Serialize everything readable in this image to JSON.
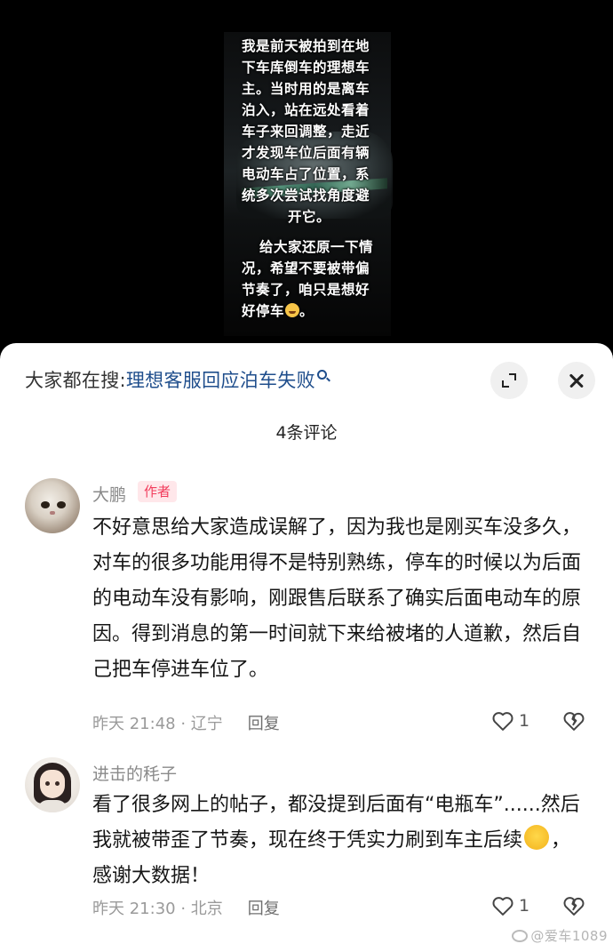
{
  "video": {
    "caption_lines_1": [
      "我是前天被拍到在地",
      "下车库倒车的理想车",
      "主。当时用的是离车",
      "泊入，站在远处看着",
      "车子来回调整，走近",
      "才发现车位后面有辆",
      "电动车占了位置，系",
      "统多次尝试找角度避",
      "开它。"
    ],
    "caption_lines_2": [
      "给大家还原一下情",
      "况，希望不要被带偏",
      "节奏了，咱只是想好"
    ],
    "caption_last": "好停车",
    "caption_last_tail": "。",
    "emoji": "sweat-smile-emoji"
  },
  "sheet": {
    "trend_prefix": "大家都在搜:",
    "trend_term": "理想客服回应泊车失败",
    "comment_count": "4条评论"
  },
  "comments": [
    {
      "user": "大鹏",
      "badge": "作者",
      "text": "不好意思给大家造成误解了，因为我也是刚买车没多久，对车的很多功能用得不是特别熟练，停车的时候以为后面的电动车没有影响，刚跟售后联系了确实后面电动车的原因。得到消息的第一时间就下来给被堵的人道歉，然后自己把车停进车位了。",
      "time": "昨天 21:48 · 辽宁",
      "reply": "回复",
      "likes": "1"
    },
    {
      "user": "进击的秏子",
      "text_before": "看了很多网上的帖子，都没提到后面有“电瓶车”......然后我就被带歪了节奏，现在终于凭实力刷到车主后续",
      "text_after": "，感谢大数据！",
      "time": "昨天 21:30 · 北京",
      "reply": "回复",
      "likes": "1"
    }
  ],
  "watermark": "@爱车1089",
  "colors": {
    "accent": "#f23c5c",
    "link": "#1f4e8c",
    "meta": "#9a9a9a"
  }
}
